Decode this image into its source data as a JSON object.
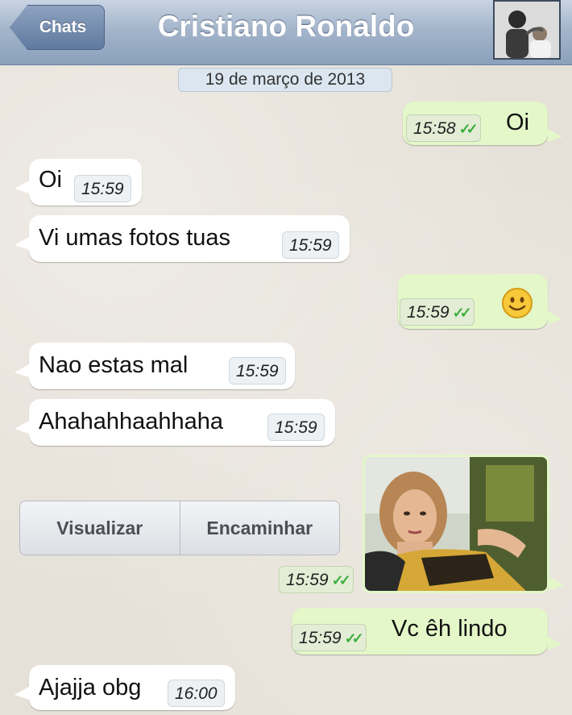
{
  "nav": {
    "back_label": "Chats",
    "title": "Cristiano Ronaldo"
  },
  "date_label": "19 de março de 2013",
  "messages": [
    {
      "direction": "outgoing",
      "text": "Oi",
      "time": "15:58",
      "status": "read"
    },
    {
      "direction": "incoming",
      "text": "Oi",
      "time": "15:59"
    },
    {
      "direction": "incoming",
      "text": "Vi umas fotos tuas",
      "time": "15:59"
    },
    {
      "direction": "outgoing",
      "emoji": "smiley",
      "time": "15:59",
      "status": "read"
    },
    {
      "direction": "incoming",
      "text": "Nao estas mal",
      "time": "15:59"
    },
    {
      "direction": "incoming",
      "text": "Ahahahhaahhaha",
      "time": "15:59"
    },
    {
      "direction": "outgoing",
      "media": "photo",
      "time": "15:59",
      "status": "read"
    },
    {
      "direction": "outgoing",
      "text": "Vc êh lindo",
      "time": "15:59",
      "status": "read"
    },
    {
      "direction": "incoming",
      "text": "Ajajja obg",
      "time": "16:00"
    }
  ],
  "media_actions": {
    "view_label": "Visualizar",
    "forward_label": "Encaminhar"
  },
  "colors": {
    "outgoing_bubble": "#e3f7c8",
    "incoming_bubble": "#ffffff",
    "read_check": "#3cae3a",
    "navbar": "#8aa0bb"
  }
}
